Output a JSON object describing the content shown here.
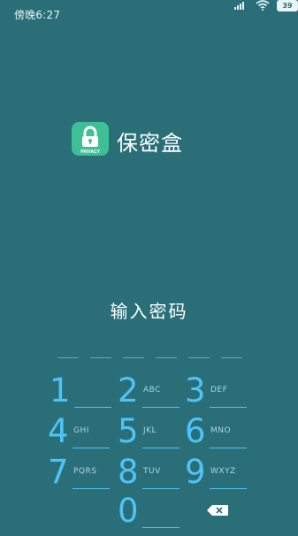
{
  "status_bar": {
    "time": "傍晚6:27",
    "battery": "39"
  },
  "app": {
    "logo_label": "PRIVACY",
    "title": "保密盒"
  },
  "prompt": "输入密码",
  "pin_slots": 6,
  "keypad": [
    {
      "digit": "1",
      "letters": ""
    },
    {
      "digit": "2",
      "letters": "ABC"
    },
    {
      "digit": "3",
      "letters": "DEF"
    },
    {
      "digit": "4",
      "letters": "GHI"
    },
    {
      "digit": "5",
      "letters": "JKL"
    },
    {
      "digit": "6",
      "letters": "MNO"
    },
    {
      "digit": "7",
      "letters": "PQRS"
    },
    {
      "digit": "8",
      "letters": "TUV"
    },
    {
      "digit": "9",
      "letters": "WXYZ"
    },
    {
      "digit": "0",
      "letters": ""
    }
  ],
  "delete_icon": "backspace-icon",
  "colors": {
    "background": "#2a6f78",
    "accent": "#4dc3f7",
    "logo": "#3fbf95"
  }
}
